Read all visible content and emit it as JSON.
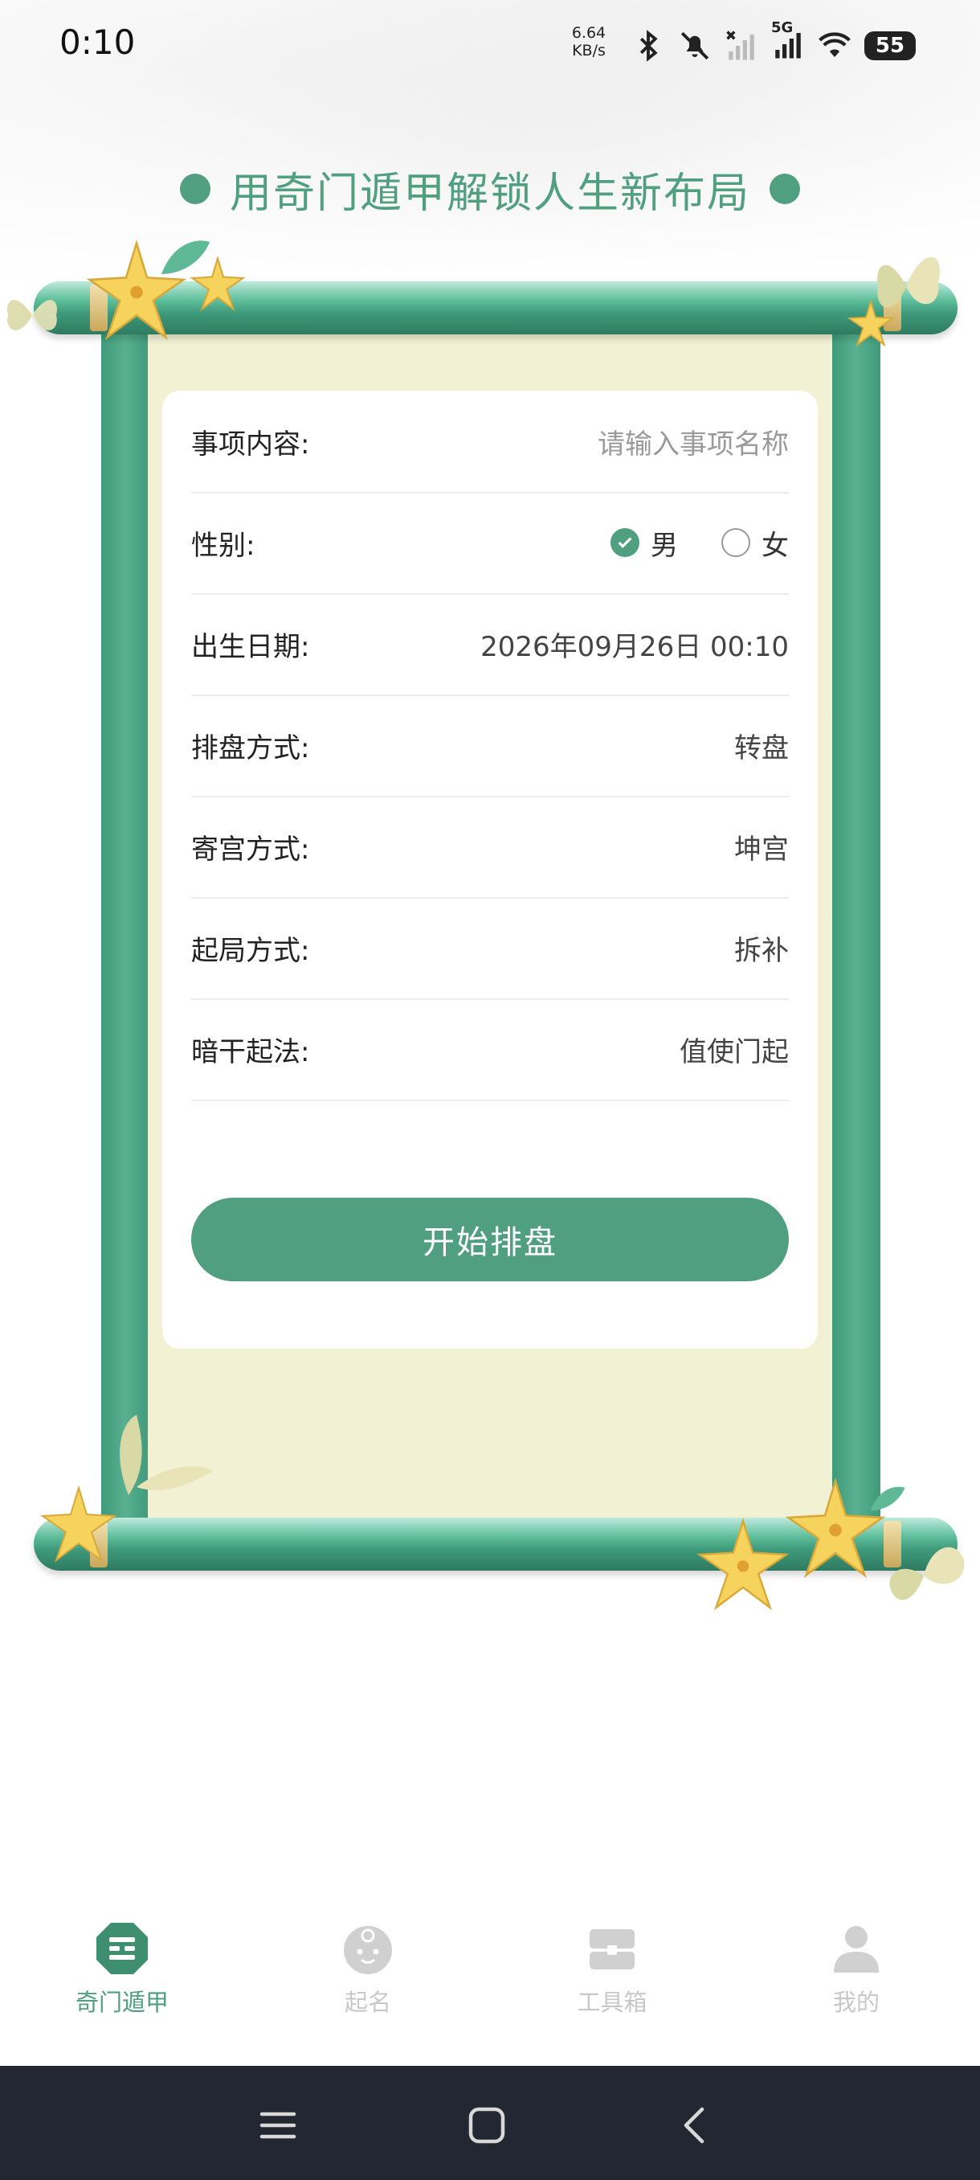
{
  "status_bar": {
    "time": "0:10",
    "net_speed_value": "6.64",
    "net_speed_unit": "KB/s",
    "network_label": "5G",
    "battery": "55",
    "icons": [
      "bluetooth-icon",
      "mute-icon",
      "no-signal-icon",
      "signal-5g-icon",
      "wifi-icon",
      "battery-icon"
    ]
  },
  "title": "用奇门遁甲解锁人生新布局",
  "form": {
    "matter": {
      "label": "事项内容:",
      "value": "",
      "placeholder": "请输入事项名称"
    },
    "gender": {
      "label": "性别:",
      "options": [
        "男",
        "女"
      ],
      "selected": "男"
    },
    "birth": {
      "label": "出生日期:",
      "value": "2026年09月26日 00:10"
    },
    "method": {
      "label": "排盘方式:",
      "value": "转盘"
    },
    "palace": {
      "label": "寄宫方式:",
      "value": "坤宫"
    },
    "start": {
      "label": "起局方式:",
      "value": "拆补"
    },
    "stem": {
      "label": "暗干起法:",
      "value": "值使门起"
    },
    "submit_label": "开始排盘"
  },
  "bottom_nav": [
    {
      "label": "奇门遁甲",
      "icon": "qimen-icon",
      "active": true
    },
    {
      "label": "起名",
      "icon": "baby-face-icon",
      "active": false
    },
    {
      "label": "工具箱",
      "icon": "toolbox-icon",
      "active": false
    },
    {
      "label": "我的",
      "icon": "user-icon",
      "active": false
    }
  ],
  "system_nav": [
    "menu-icon",
    "home-icon",
    "back-icon"
  ],
  "colors": {
    "accent": "#4f9f80",
    "paper": "#f2f1d3",
    "system_bar": "#232731"
  }
}
